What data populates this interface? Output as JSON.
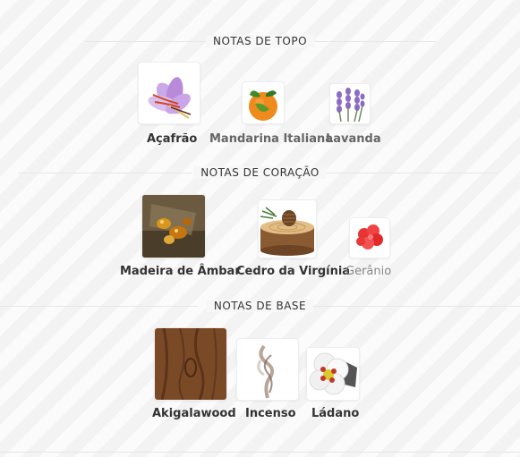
{
  "sections": [
    {
      "title": "NOTAS DE TOPO",
      "notes": [
        {
          "label": "Açafrão",
          "icon": "saffron-icon"
        },
        {
          "label": "Mandarina Italiana",
          "icon": "mandarin-icon"
        },
        {
          "label": "Lavanda",
          "icon": "lavender-icon"
        }
      ]
    },
    {
      "title": "NOTAS DE CORAÇÃO",
      "notes": [
        {
          "label": "Madeira de Âmbar",
          "icon": "amber-wood-icon"
        },
        {
          "label": "Cedro da Virgínia",
          "icon": "virginia-cedar-icon"
        },
        {
          "label": "Gerânio",
          "icon": "geranium-icon"
        }
      ]
    },
    {
      "title": "NOTAS DE BASE",
      "notes": [
        {
          "label": "Akigalawood",
          "icon": "akigalawood-icon"
        },
        {
          "label": "Incenso",
          "icon": "incense-icon"
        },
        {
          "label": "Ládano",
          "icon": "labdanum-icon"
        }
      ]
    }
  ]
}
